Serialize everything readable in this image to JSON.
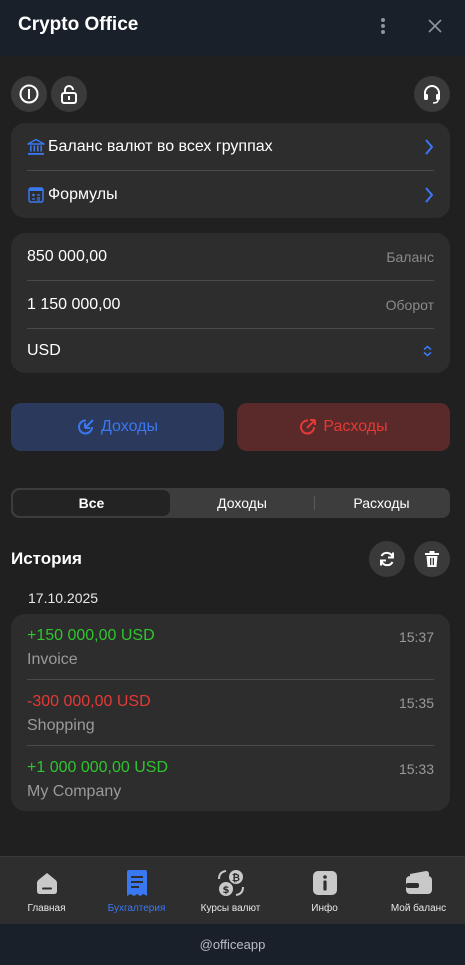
{
  "header": {
    "title": "Crypto Office"
  },
  "menu_card": {
    "items": [
      {
        "label": "Баланс валют во всех группах",
        "icon": "bank-icon"
      },
      {
        "label": "Формулы",
        "icon": "calculator-icon"
      }
    ]
  },
  "fields_card": {
    "balance": {
      "value": "850 000,00",
      "hint": "Баланс"
    },
    "turnover": {
      "value": "1 150 000,00",
      "hint": "Оборот"
    },
    "currency": {
      "value": "USD"
    }
  },
  "actions": {
    "income_label": "Доходы",
    "expense_label": "Расходы"
  },
  "filter": {
    "options": [
      "Все",
      "Доходы",
      "Расходы"
    ],
    "selected": "Все"
  },
  "history": {
    "title": "История",
    "date": "17.10.2025",
    "transactions": [
      {
        "amount": "+150 000,00 USD",
        "name": "Invoice",
        "time": "15:37",
        "type": "income"
      },
      {
        "amount": "-300 000,00 USD",
        "name": "Shopping",
        "time": "15:35",
        "type": "expense"
      },
      {
        "amount": "+1 000 000,00 USD",
        "name": "My Company",
        "time": "15:33",
        "type": "income"
      }
    ]
  },
  "tabbar": {
    "tabs": [
      {
        "label": "Главная",
        "icon": "home-icon",
        "active": false
      },
      {
        "label": "Бухгалтерия",
        "icon": "receipt-icon",
        "active": true
      },
      {
        "label": "Курсы валют",
        "icon": "currency-exchange-icon",
        "active": false
      },
      {
        "label": "Инфо",
        "icon": "info-icon",
        "active": false
      },
      {
        "label": "Мой баланс",
        "icon": "wallet-icon",
        "active": false
      }
    ]
  },
  "footer": {
    "text": "@officeapp"
  },
  "colors": {
    "accent": "#3a78f2",
    "income": "#2ec52e",
    "expense": "#e53935",
    "income_button_bg": "#2b3a5c",
    "expense_button_bg": "#5a2a2a"
  }
}
